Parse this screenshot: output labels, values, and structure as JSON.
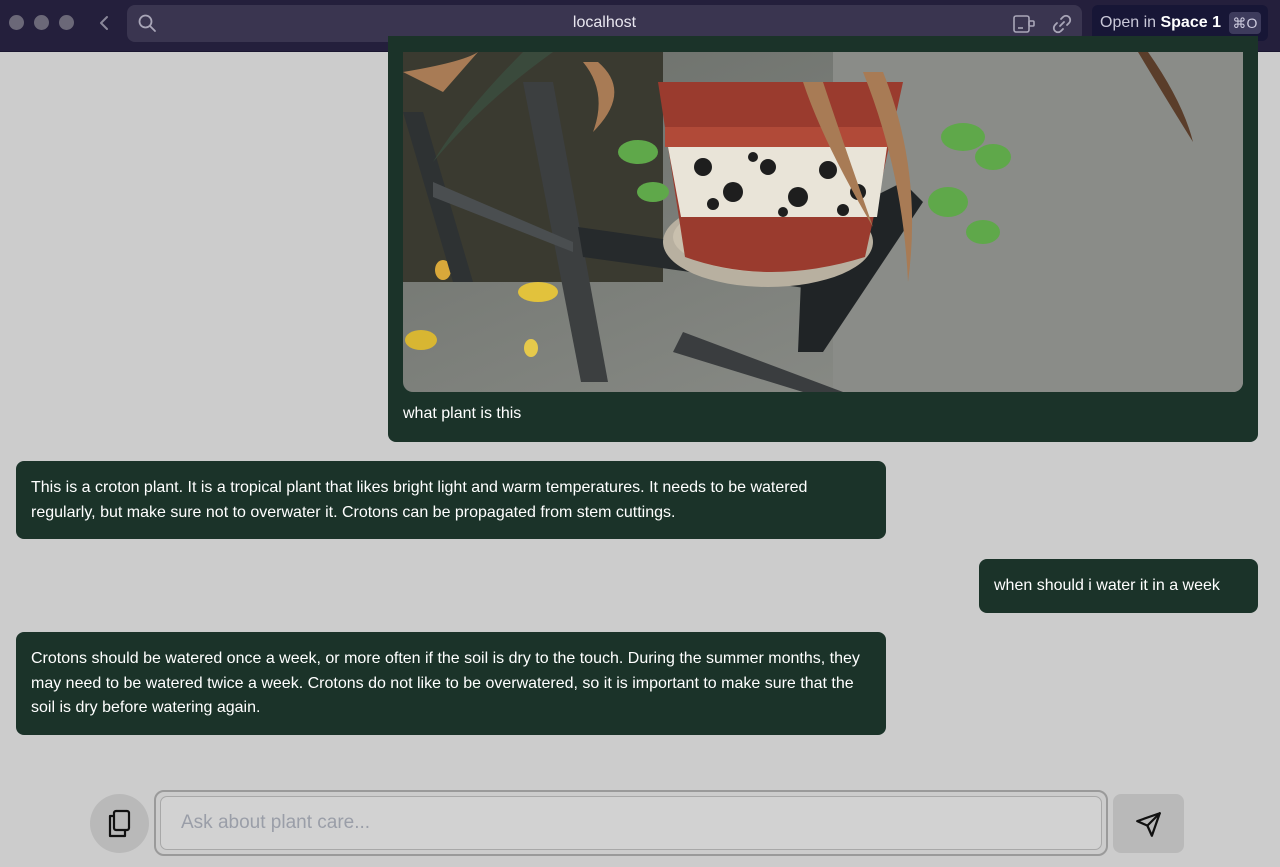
{
  "browser": {
    "url": "localhost",
    "open_in_prefix": "Open in ",
    "space_name": "Space 1",
    "shortcut": "⌘O",
    "icons": [
      "back-icon",
      "search-icon",
      "extension-icon",
      "link-icon"
    ]
  },
  "chat": {
    "messages": [
      {
        "role": "user",
        "image": "photo of potted plant on metal stand",
        "text": "what plant is this"
      },
      {
        "role": "assistant",
        "text": "This is a croton plant. It is a tropical plant that likes bright light and warm temperatures. It needs to be watered regularly, but make sure not to overwater it. Crotons can be propagated from stem cuttings."
      },
      {
        "role": "user",
        "text": "when should i water it in a week"
      },
      {
        "role": "assistant",
        "text": "Crotons should be watered once a week, or more often if the soil is dry to the touch. During the summer months, they may need to be watered twice a week. Crotons do not like to be overwatered, so it is important to make sure that the soil is dry before watering again."
      }
    ]
  },
  "composer": {
    "placeholder": "Ask about plant care...",
    "value": "",
    "icons": [
      "copy-icon",
      "send-icon"
    ]
  },
  "colors": {
    "bubble": "#1b3329",
    "background": "#cccccc",
    "titlebar": "#241f3c"
  }
}
